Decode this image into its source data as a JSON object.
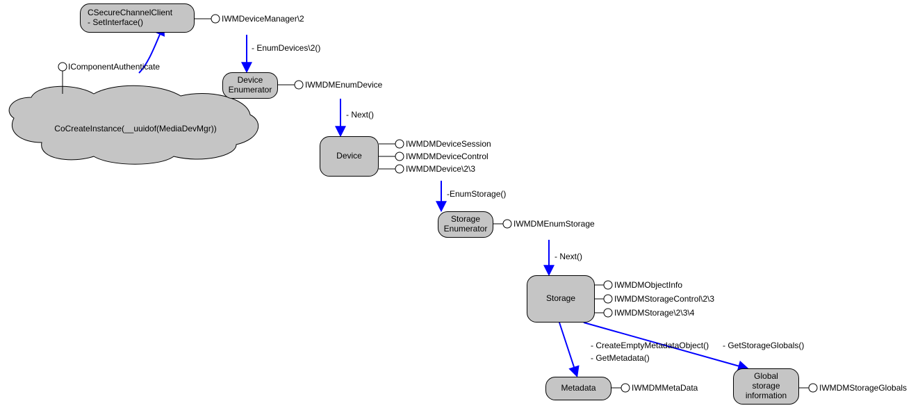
{
  "nodes": {
    "secure": {
      "line1": "CSecureChannelClient",
      "line2": "- SetInterface()"
    },
    "cloud": {
      "text": "CoCreateInstance(__uuidof(MediaDevMgr))"
    },
    "devenum": {
      "line1": "Device",
      "line2": "Enumerator"
    },
    "device": {
      "text": "Device"
    },
    "storenum": {
      "line1": "Storage",
      "line2": "Enumerator"
    },
    "storage": {
      "text": "Storage"
    },
    "metadata": {
      "text": "Metadata"
    },
    "global": {
      "line1": "Global",
      "line2": "storage",
      "line3": "information"
    }
  },
  "lollipops": {
    "icomponentauth": "IComponentAuthenticate",
    "iwmdevicemanager": "IWMDeviceManager\\2",
    "iwmdmenumdevice": "IWMDMEnumDevice",
    "iwmdmdevicesession": "IWMDMDeviceSession",
    "iwmdmdevicecontrol": "IWMDMDeviceControl",
    "iwmdmdevice": "IWMDMDevice\\2\\3",
    "iwmdmenumstorage": "IWMDMEnumStorage",
    "iwmdmobjectinfo": "IWMDMObjectInfo",
    "iwmdmstoragecontrol": "IWMDMStorageControl\\2\\3",
    "iwmdmstorage": "IWMDMStorage\\2\\3\\4",
    "iwmdmmetadata": "IWMDMMetaData",
    "iwmdmstorageglobals": "IWMDMStorageGlobals"
  },
  "edges": {
    "enumdevices": "- EnumDevices\\2()",
    "next1": "- Next()",
    "enumstorage": "-EnumStorage()",
    "next2": "- Next()",
    "createemptymeta": "- CreateEmptyMetadataObject()",
    "getmetadata": "- GetMetadata()",
    "getstorageglobals": "- GetStorageGlobals()"
  }
}
